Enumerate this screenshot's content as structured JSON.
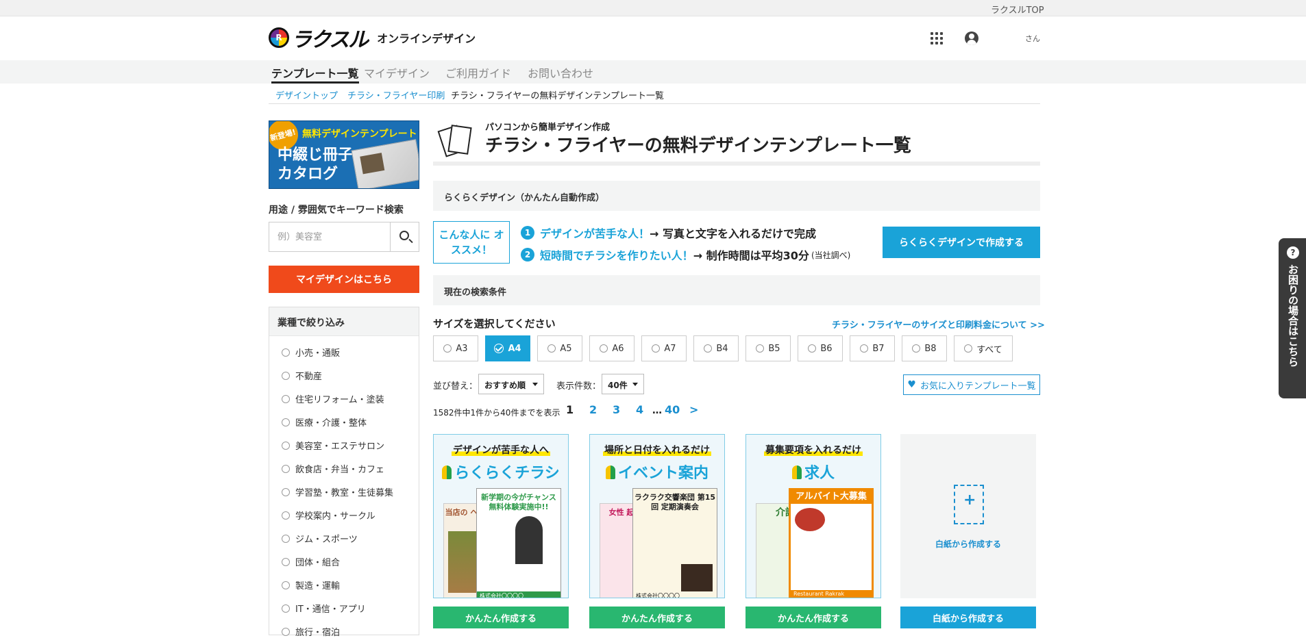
{
  "topbar": {
    "link": "ラクスルTOP"
  },
  "header": {
    "logo": "ラクスル",
    "service": "オンラインデザイン",
    "apps_icon": "grid-icon",
    "user_icon": "user-circle-icon",
    "user_name": "さん"
  },
  "nav": {
    "items": [
      "テンプレート一覧",
      "マイデザイン",
      "ご利用ガイド",
      "お問い合わせ"
    ],
    "active": 0
  },
  "breadcrumb": [
    "デザイントップ",
    "チラシ・フライヤー印刷",
    "チラシ・フライヤーの無料デザインテンプレート一覧"
  ],
  "sidebar": {
    "banner": {
      "badge": "新登場!",
      "line1": "無料デザインテンプレート",
      "line2": "中綴じ冊子カタログ"
    },
    "keyword_label": "用途 / 雰囲気でキーワード検索",
    "keyword_placeholder": "例）美容室",
    "search_icon": "search-icon",
    "mydesign_button": "マイデザインはこちら",
    "filter_title": "業種で絞り込み",
    "industries": [
      "小売・通販",
      "不動産",
      "住宅リフォーム・塗装",
      "医療・介護・整体",
      "美容室・エステサロン",
      "飲食店・弁当・カフェ",
      "学習塾・教室・生徒募集",
      "学校案内・サークル",
      "ジム・スポーツ",
      "団体・組合",
      "製造・運輸",
      "IT・通信・アプリ",
      "旅行・宿泊"
    ]
  },
  "main": {
    "subtitle": "パソコンから簡単デザイン作成",
    "title": "チラシ・フライヤーの無料デザインテンプレート一覧",
    "rakuraku_section": "らくらくデザイン（かんたん自動作成）",
    "recommend": {
      "badge": "こんな人に オススメ！",
      "line1_num": "1",
      "line1_hl": "デザインが苦手な人！",
      "line1_rest": "→ 写真と文字を入れるだけで完成",
      "line2_num": "2",
      "line2_hl": "短時間でチラシを作りたい人！",
      "line2_rest": "→ 制作時間は平均30分",
      "line2_note": "(当社調べ)"
    },
    "rakuraku_button": "らくらくデザインで作成する",
    "conditions_section": "現在の検索条件",
    "size_label": "サイズを選択してください",
    "size_link": "チラシ・フライヤーのサイズと印刷料金について >>",
    "sizes": [
      "A3",
      "A4",
      "A5",
      "A6",
      "A7",
      "B4",
      "B5",
      "B6",
      "B7",
      "B8",
      "すべて"
    ],
    "selected_size": "A4",
    "sort_label": "並び替え：",
    "sort_value": "おすすめ順",
    "per_page_label": "表示件数：",
    "per_page_value": "40件",
    "favorites_button": "お気に入りテンプレート一覧",
    "result_count": "1582件中1件から40件までを表示",
    "pagination": [
      "1",
      "2",
      "3",
      "4",
      "…",
      "40",
      ">"
    ]
  },
  "cards": [
    {
      "caption": "デザインが苦手な人へ",
      "title": "らくらくチラシ",
      "thumb_back": "当店の ヘルシー",
      "thumb_front": "新学期の今がチャンス 無料体験実施中!!",
      "thumb_foot": "株式会社〇〇〇〇",
      "front_color": "#2e9a4a",
      "button": "かんたん作成する"
    },
    {
      "caption": "場所と日付を入れるだけ",
      "title": "イベント案内",
      "thumb_back": "女性 起業支",
      "thumb_front": "ラクラク交響楽団 第15回 定期演奏会",
      "thumb_foot": "株式会社〇〇〇〇",
      "front_color": "#222222",
      "button": "かんたん作成する"
    },
    {
      "caption": "募集要項を入れるだけ",
      "title": "求人",
      "thumb_back": "介護",
      "thumb_front": "アルバイト大募集",
      "thumb_foot": "Restaurant Rakrak",
      "front_color": "#f08a00",
      "button": "かんたん作成する"
    }
  ],
  "blank_card": {
    "text": "白紙から作成する",
    "button": "白紙から作成する"
  },
  "help_tab": {
    "icon": "question-icon",
    "text": "お困りの場合はこちら"
  }
}
